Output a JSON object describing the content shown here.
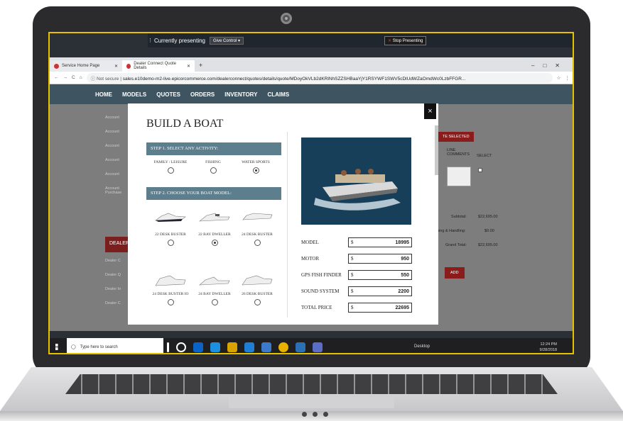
{
  "presenting": {
    "label": "Currently presenting",
    "give_control": "Give Control",
    "stop": "Stop Presenting"
  },
  "browser": {
    "tabs": [
      {
        "label": "Service Home Page"
      },
      {
        "label": "Dealer Connect Quote Details"
      }
    ],
    "not_secure": "Not secure",
    "url": "sales.e10demo-m2-live.epicorcommerce.com/dealerconnect/quotes/details/quote/MDoyOkVLb2dKRlNhSZZSHBaaYjY1RSYWF1SWV5cDlUdWZaOmdWc0LzbFFGR..."
  },
  "nav": {
    "items": [
      "HOME",
      "MODELS",
      "QUOTES",
      "ORDERS",
      "INVENTORY",
      "CLAIMS"
    ]
  },
  "background": {
    "side_items": [
      "Account",
      "Account",
      "Account",
      "Account",
      "Account",
      "Account Purchase"
    ],
    "dealer": "DEALER",
    "dealer_items": [
      "Dealer C",
      "Dealer Q",
      "Dealer In",
      "Dealer C"
    ],
    "te_selected": "TE SELECTED",
    "line_comments": "LINE COMMENTS",
    "select": "SELECT",
    "subtotal_label": "Subtotal:",
    "subtotal": "$22,695.00",
    "shipping_label": "ping & Handling:",
    "shipping": "$0.00",
    "grand_label": "Grand Total:",
    "grand": "$22,695.00",
    "add": "ADD"
  },
  "modal": {
    "title": "BUILD A BOAT",
    "close": "×",
    "step1": "STEP 1. SELECT ANY ACTIVITY:",
    "activities": [
      {
        "label": "FAMILY / LEISURE",
        "selected": false
      },
      {
        "label": "FISHING",
        "selected": false
      },
      {
        "label": "WATER SPORTS",
        "selected": true
      }
    ],
    "step2": "STEP 2. CHOOSE YOUR BOAT MODEL:",
    "models": [
      {
        "label": "22 DESK BUSTER",
        "selected": false
      },
      {
        "label": "22 BAY DWELLER",
        "selected": true
      },
      {
        "label": "24 DESK BUSTER",
        "selected": false
      },
      {
        "label": "24 DESK BUSTER IO",
        "selected": false
      },
      {
        "label": "24 BAY DWELLER",
        "selected": false
      },
      {
        "label": "26 DESK BUSTER",
        "selected": false
      }
    ],
    "prices": [
      {
        "label": "MODEL",
        "currency": "$",
        "value": "18995"
      },
      {
        "label": "MOTOR",
        "currency": "$",
        "value": "950"
      },
      {
        "label": "GPS FISH FINDER",
        "currency": "$",
        "value": "550"
      },
      {
        "label": "SOUND SYSTEM",
        "currency": "$",
        "value": "2200"
      },
      {
        "label": "TOTAL PRICE",
        "currency": "$",
        "value": "22695"
      }
    ]
  },
  "taskbar": {
    "search": "Type here to search",
    "desktop": "Desktop",
    "time": "12:24 PM",
    "date": "9/28/2018"
  }
}
